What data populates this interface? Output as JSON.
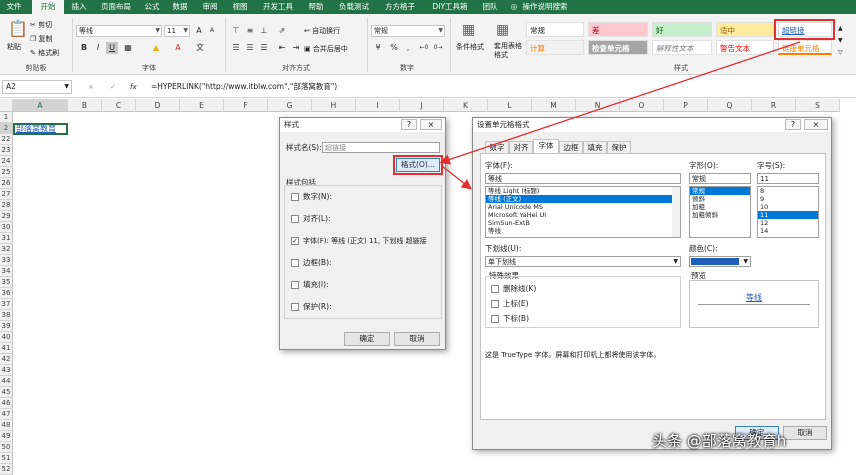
{
  "ribbon": {
    "tabs": [
      "文件",
      "开始",
      "插入",
      "页面布局",
      "公式",
      "数据",
      "审阅",
      "视图",
      "开发工具",
      "帮助",
      "负载测试",
      "方方格子",
      "DIY工具箱",
      "团队"
    ],
    "active_tab": "开始",
    "tell_me": "操作说明搜索",
    "clipboard": {
      "paste": "粘贴",
      "cut": "剪切",
      "copy": "复制",
      "format_painter": "格式刷",
      "label": "剪贴板"
    },
    "font": {
      "name": "等线",
      "size": "11",
      "bold": "B",
      "italic": "I",
      "underline": "U",
      "label": "字体"
    },
    "alignment": {
      "wrap": "自动换行",
      "merge": "合并后居中",
      "label": "对齐方式"
    },
    "number": {
      "format": "常规",
      "label": "数字"
    },
    "cond_format": "条件格式",
    "table_format": "套用表格格式",
    "styles": {
      "label": "样式",
      "items": [
        "常规",
        "差",
        "好",
        "适中",
        "超链接",
        "计算",
        "检查单元格",
        "解释性文本",
        "警告文本",
        "链接单元格"
      ]
    }
  },
  "formula_bar": {
    "cell_ref": "A2",
    "cancel": "×",
    "enter": "✓",
    "fx": "fx",
    "formula": "=HYPERLINK(\"http://www.itblw.com\",\"部落窝教育\")"
  },
  "grid": {
    "columns": [
      "A",
      "B",
      "C",
      "D",
      "E",
      "F",
      "G",
      "H",
      "I",
      "J",
      "K",
      "L",
      "M",
      "N",
      "O",
      "P",
      "Q",
      "R",
      "S"
    ],
    "rows": [
      "1",
      "2",
      "22",
      "23",
      "24",
      "25",
      "26",
      "27",
      "28",
      "29",
      "30",
      "31",
      "32",
      "33",
      "34",
      "35",
      "36",
      "37",
      "38",
      "39",
      "40",
      "41",
      "42",
      "43",
      "44",
      "45",
      "46",
      "47",
      "48",
      "49",
      "50",
      "51",
      "52"
    ],
    "cell_a2": "部落窝教育"
  },
  "style_dialog": {
    "title": "样式",
    "help": "?",
    "close": "×",
    "style_name_label": "样式名(S):",
    "style_name_value": "超链接",
    "format_button": "格式(O)...",
    "includes_label": "样式包括",
    "options": [
      {
        "label": "数字(N):",
        "checked": false
      },
      {
        "label": "对齐(L):",
        "checked": false
      },
      {
        "label": "字体(F): 等线 (正文) 11, 下划线 超链接",
        "checked": true
      },
      {
        "label": "边框(B):",
        "checked": false
      },
      {
        "label": "填充(I):",
        "checked": false
      },
      {
        "label": "保护(R):",
        "checked": false
      }
    ],
    "ok": "确定",
    "cancel": "取消"
  },
  "format_dialog": {
    "title": "设置单元格格式",
    "help": "?",
    "close": "×",
    "tabs": [
      "数字",
      "对齐",
      "字体",
      "边框",
      "填充",
      "保护"
    ],
    "active_tab": "字体",
    "font_label": "字体(F):",
    "font_value": "等线",
    "font_list": [
      "等线 Light (标题)",
      "等线 (正文)",
      "Arial Unicode MS",
      "Microsoft YaHei UI",
      "SimSun-ExtB",
      "等线"
    ],
    "font_selected": "等线 (正文)",
    "style_label": "字形(O):",
    "style_value": "常规",
    "style_list": [
      "常规",
      "倾斜",
      "加粗",
      "加粗倾斜"
    ],
    "style_selected": "常规",
    "size_label": "字号(S):",
    "size_value": "11",
    "size_list": [
      "8",
      "9",
      "10",
      "11",
      "12",
      "14"
    ],
    "size_selected": "11",
    "underline_label": "下划线(U):",
    "underline_value": "单下划线",
    "color_label": "颜色(C):",
    "color_value": "#1f5fb8",
    "effects_label": "特殊效果",
    "effects": [
      "删除线(K)",
      "上标(E)",
      "下标(B)"
    ],
    "preview_label": "预览",
    "preview_text": "等线",
    "description": "这是 TrueType 字体。屏幕和打印机上都将使用该字体。",
    "ok": "确定",
    "cancel": "取消"
  },
  "watermark": "头条 @部落窝教育h",
  "colors": {
    "excel_green": "#217346",
    "link_blue": "#1f5fb8",
    "annotation_red": "#e03030"
  }
}
